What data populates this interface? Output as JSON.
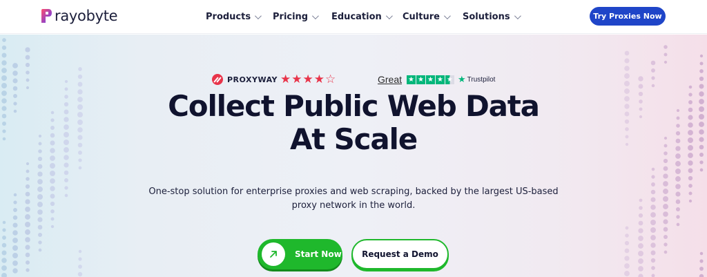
{
  "brand": {
    "name": "rayobyte"
  },
  "nav": {
    "items": [
      {
        "label": "Products"
      },
      {
        "label": "Pricing"
      },
      {
        "label": "Education"
      },
      {
        "label": "Culture"
      },
      {
        "label": "Solutions"
      }
    ],
    "cta_label": "Try Proxies Now"
  },
  "ratings": {
    "proxyway": {
      "name": "PROXYWAY",
      "rating": 4,
      "max": 5,
      "color": "#e8344a"
    },
    "trustpilot": {
      "label": "Great",
      "name": "Trustpilot",
      "rating": 4.5,
      "max": 5,
      "color": "#00b67a"
    }
  },
  "hero": {
    "headline_line1": "Collect Public Web Data",
    "headline_line2": "At Scale",
    "subtitle_line1": "One-stop solution for enterprise proxies and web scraping, backed by the largest US-based",
    "subtitle_line2": "proxy network in the world.",
    "primary_cta": "Start Now",
    "secondary_cta": "Request a Demo"
  },
  "colors": {
    "accent_blue": "#1f45c8",
    "accent_green": "#1fb82c",
    "text_dark": "#10132e"
  },
  "icons": {
    "logo": "rayobyte-logo-icon",
    "nav_chevron": "chevron-down-icon",
    "start_arrow": "arrow-up-right-icon"
  }
}
